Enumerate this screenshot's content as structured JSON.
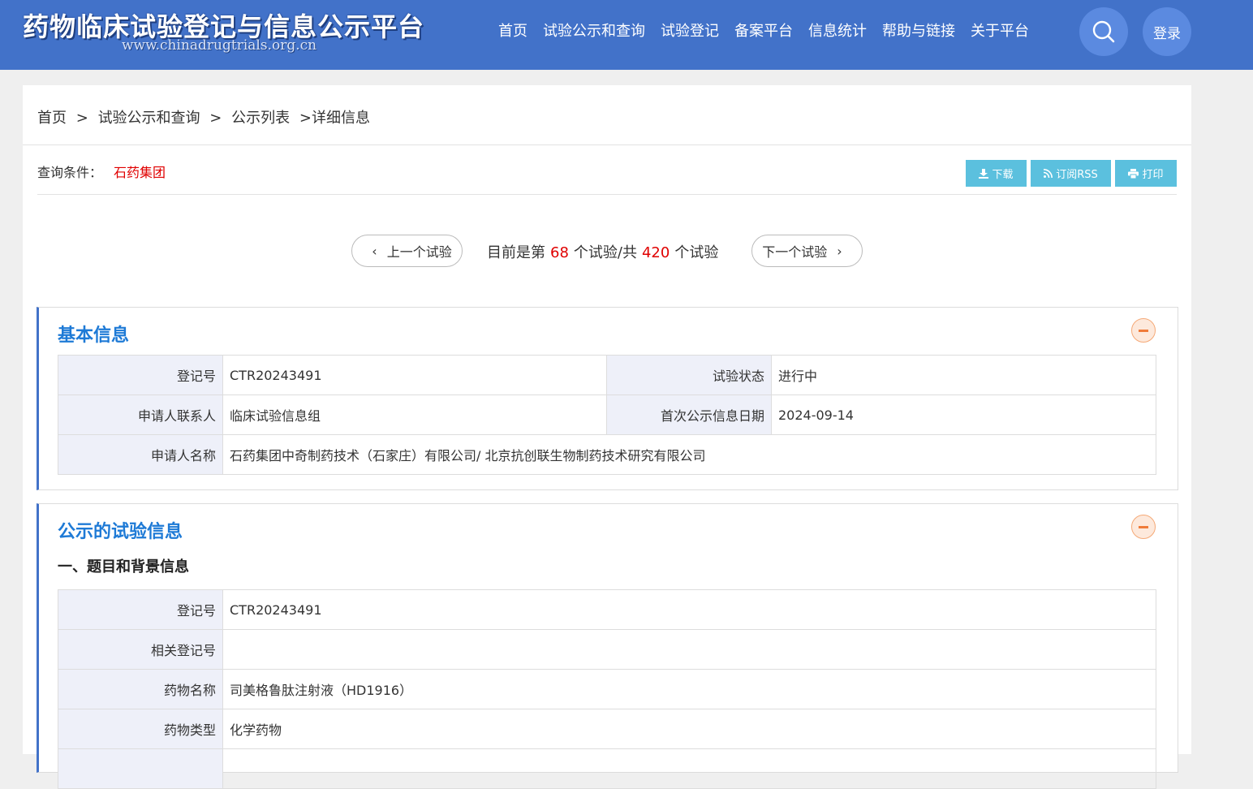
{
  "header": {
    "logo_title": "药物临床试验登记与信息公示平台",
    "logo_url": "www.chinadrugtrials.org.cn",
    "nav": [
      "首页",
      "试验公示和查询",
      "试验登记",
      "备案平台",
      "信息统计",
      "帮助与链接",
      "关于平台"
    ],
    "search_icon": "search-icon",
    "login_label": "登录"
  },
  "breadcrumb": {
    "items": [
      "首页",
      "试验公示和查询",
      "公示列表",
      "详细信息"
    ],
    "separator": ">"
  },
  "query": {
    "label": "查询条件：",
    "value": "石药集团"
  },
  "toolbar": {
    "download_label": "下载",
    "rss_label": "订阅RSS",
    "print_label": "打印"
  },
  "pager": {
    "prev_label": "上一个试验",
    "next_label": "下一个试验",
    "text_prefix": "目前是第",
    "current": "68",
    "text_mid": "个试验/共",
    "total": "420",
    "text_suffix": "个试验"
  },
  "basic_info": {
    "title": "基本信息",
    "rows": [
      {
        "label": "登记号",
        "value": "CTR20243491",
        "label2": "试验状态",
        "value2": "进行中"
      },
      {
        "label": "申请人联系人",
        "value": "临床试验信息组",
        "label2": "首次公示信息日期",
        "value2": "2024-09-14"
      },
      {
        "label": "申请人名称",
        "value": "石药集团中奇制药技术（石家庄）有限公司/ 北京抗创联生物制药技术研究有限公司"
      }
    ]
  },
  "trial_info": {
    "title": "公示的试验信息",
    "section_title": "一、题目和背景信息",
    "rows": [
      {
        "label": "登记号",
        "value": "CTR20243491"
      },
      {
        "label": "相关登记号",
        "value": ""
      },
      {
        "label": "药物名称",
        "value": "司美格鲁肽注射液（HD1916）"
      },
      {
        "label": "药物类型",
        "value": "化学药物"
      },
      {
        "label": "",
        "value": ""
      }
    ]
  },
  "colors": {
    "header_bg": "#4272c9",
    "accent_blue": "#1e7ad6",
    "highlight_red": "#e00000",
    "tool_button": "#5bc0de",
    "label_bg": "#eef0f9",
    "collapse_orange": "#f07c3a"
  }
}
